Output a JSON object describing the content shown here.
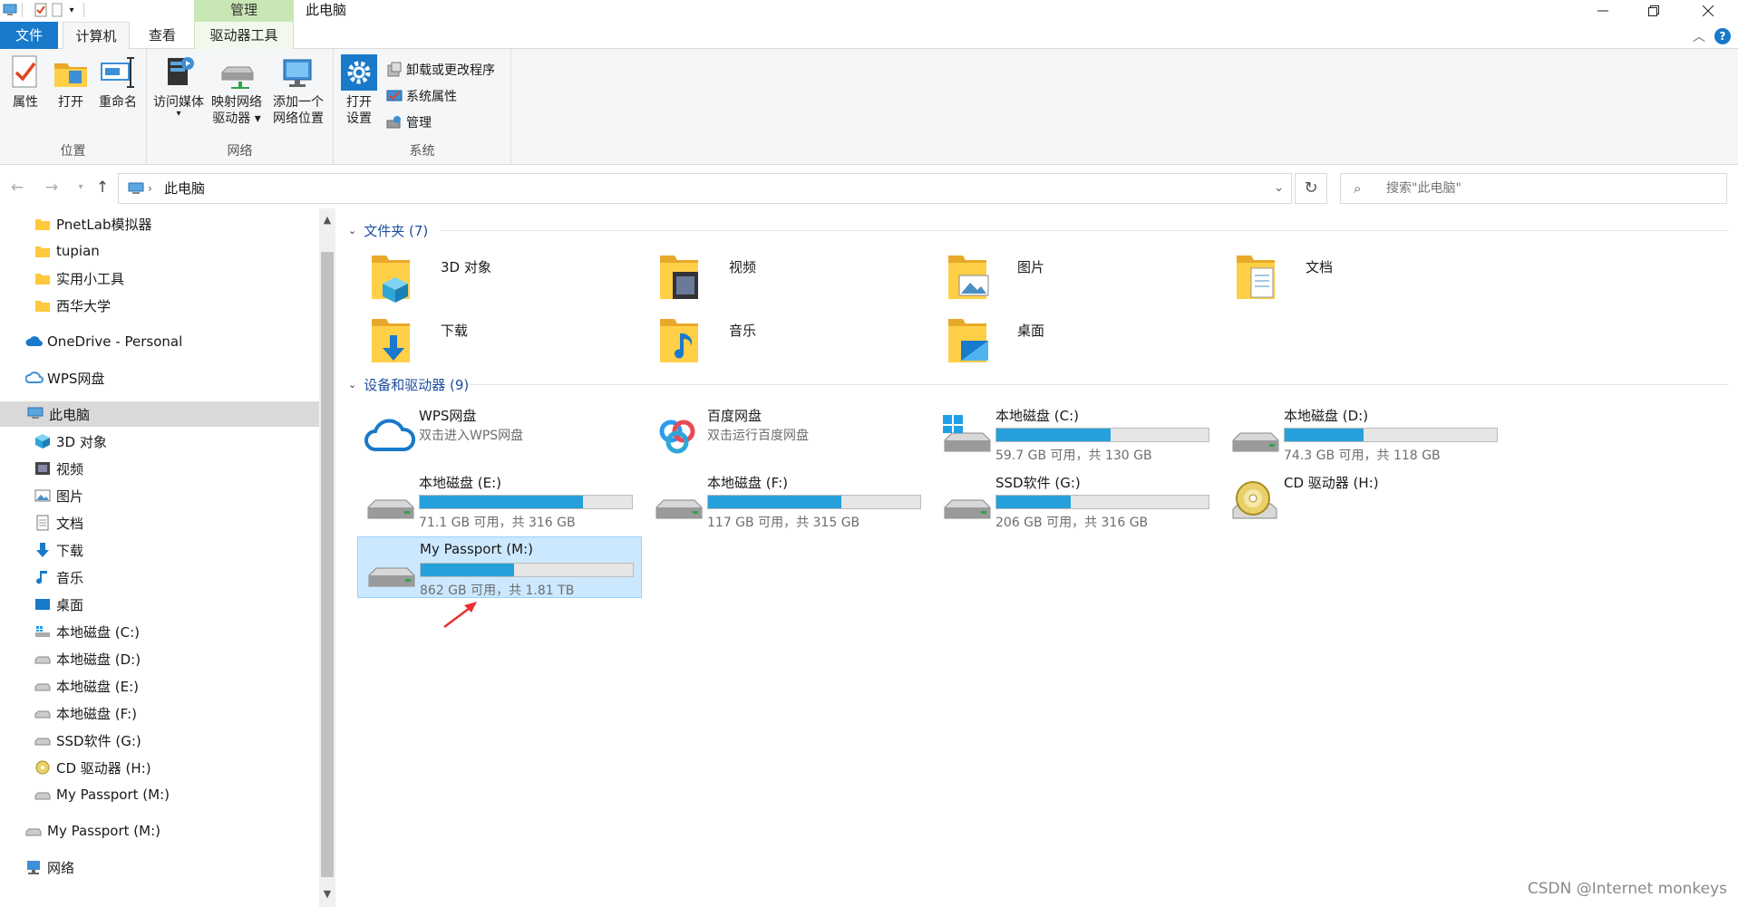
{
  "titlebar": {
    "context_tab": "管理",
    "window_title": "此电脑"
  },
  "tabs": {
    "file": "文件",
    "computer": "计算机",
    "view": "查看",
    "drive_tools": "驱动器工具"
  },
  "ribbon": {
    "location_group": "位置",
    "network_group": "网络",
    "system_group": "系统",
    "properties": "属性",
    "open": "打开",
    "rename": "重命名",
    "access_media": "访问媒体",
    "map_drive_1": "映射网络",
    "map_drive_2": "驱动器",
    "add_location_1": "添加一个",
    "add_location_2": "网络位置",
    "open_settings_1": "打开",
    "open_settings_2": "设置",
    "uninstall": "卸载或更改程序",
    "system_props": "系统属性",
    "manage": "管理"
  },
  "address": {
    "path": "此电脑",
    "search_placeholder": "搜索\"此电脑\""
  },
  "nav_pane": {
    "items": [
      {
        "label": "PnetLab模拟器"
      },
      {
        "label": "tupian"
      },
      {
        "label": "实用小工具"
      },
      {
        "label": "西华大学"
      },
      {
        "label": "OneDrive - Personal"
      },
      {
        "label": "WPS网盘"
      },
      {
        "label": "此电脑"
      },
      {
        "label": "3D 对象"
      },
      {
        "label": "视频"
      },
      {
        "label": "图片"
      },
      {
        "label": "文档"
      },
      {
        "label": "下载"
      },
      {
        "label": "音乐"
      },
      {
        "label": "桌面"
      },
      {
        "label": "本地磁盘 (C:)"
      },
      {
        "label": "本地磁盘 (D:)"
      },
      {
        "label": "本地磁盘 (E:)"
      },
      {
        "label": "本地磁盘 (F:)"
      },
      {
        "label": "SSD软件 (G:)"
      },
      {
        "label": "CD 驱动器 (H:)"
      },
      {
        "label": "My Passport (M:)"
      },
      {
        "label": "My Passport (M:)"
      },
      {
        "label": "网络"
      }
    ]
  },
  "content": {
    "folders_header": "文件夹 (7)",
    "devices_header": "设备和驱动器 (9)",
    "folders": [
      {
        "name": "3D 对象"
      },
      {
        "name": "视频"
      },
      {
        "name": "图片"
      },
      {
        "name": "文档"
      },
      {
        "name": "下载"
      },
      {
        "name": "音乐"
      },
      {
        "name": "桌面"
      }
    ],
    "drives": [
      {
        "name": "WPS网盘",
        "sub": "双击进入WPS网盘"
      },
      {
        "name": "百度网盘",
        "sub": "双击运行百度网盘"
      },
      {
        "name": "本地磁盘 (C:)",
        "info": "59.7 GB 可用，共 130 GB",
        "used_pct": 54
      },
      {
        "name": "本地磁盘 (D:)",
        "info": "74.3 GB 可用，共 118 GB",
        "used_pct": 37
      },
      {
        "name": "本地磁盘 (E:)",
        "info": "71.1 GB 可用，共 316 GB",
        "used_pct": 77
      },
      {
        "name": "本地磁盘 (F:)",
        "info": "117 GB 可用，共 315 GB",
        "used_pct": 63
      },
      {
        "name": "SSD软件 (G:)",
        "info": "206 GB 可用，共 316 GB",
        "used_pct": 35
      },
      {
        "name": "CD 驱动器 (H:)"
      },
      {
        "name": "My Passport (M:)",
        "info": "862 GB 可用，共 1.81 TB",
        "used_pct": 44
      }
    ]
  },
  "watermark": "CSDN @Internet monkeys",
  "colors": {
    "accent": "#1979ca",
    "drive_bar": "#26a0da",
    "selection": "#cce8ff",
    "context_tab": "#c9e7b5",
    "annotation_arrow": "#e8322e"
  }
}
